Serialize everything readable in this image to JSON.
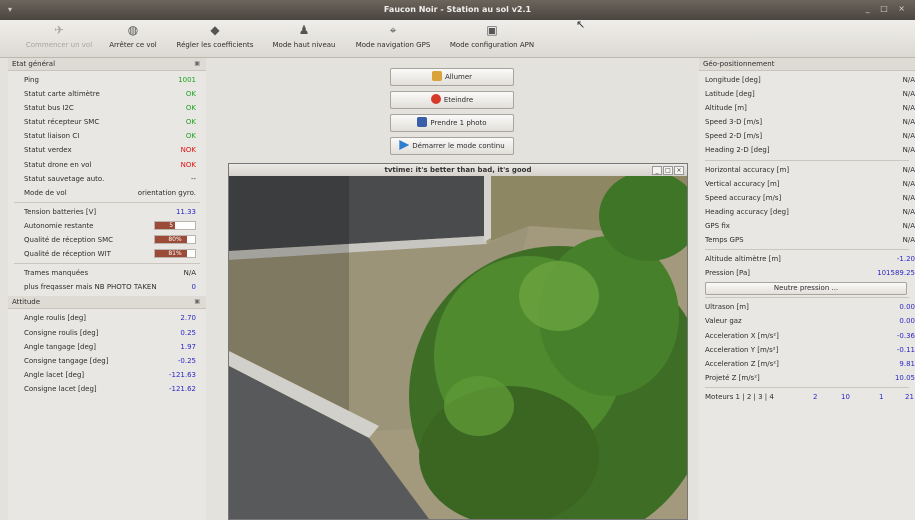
{
  "window": {
    "title": "Faucon Noir - Station au sol v2.1",
    "controls": [
      "_",
      "□",
      "×"
    ]
  },
  "toolbar": {
    "items": [
      {
        "label": "Commencer un vol",
        "icon": "plane-icon",
        "glyph": "✈",
        "enabled": false
      },
      {
        "label": "Arrêter ce vol",
        "icon": "globe-icon",
        "glyph": "◍",
        "enabled": true
      },
      {
        "label": "Régler les coefficients",
        "icon": "graduation-cap-icon",
        "glyph": "◆",
        "enabled": true
      },
      {
        "label": "Mode haut niveau",
        "icon": "joystick-icon",
        "glyph": "♟",
        "enabled": true
      },
      {
        "label": "Mode navigation GPS",
        "icon": "gps-icon",
        "glyph": "⌖",
        "enabled": true
      },
      {
        "label": "Mode configuration APN",
        "icon": "camera-config-icon",
        "glyph": "▣",
        "enabled": true
      }
    ]
  },
  "left": {
    "etat": {
      "title": "Etat général",
      "rows": [
        {
          "label": "Ping",
          "value": "1001",
          "status": "ok"
        },
        {
          "label": "Statut carte altimètre",
          "value": "OK",
          "status": "ok"
        },
        {
          "label": "Statut bus I2C",
          "value": "OK",
          "status": "ok"
        },
        {
          "label": "Statut récepteur SMC",
          "value": "OK",
          "status": "ok"
        },
        {
          "label": "Statut liaison CI",
          "value": "OK",
          "status": "ok"
        },
        {
          "label": "Statut verdex",
          "value": "NOK",
          "status": "nok"
        },
        {
          "label": "Statut drone en vol",
          "value": "NOK",
          "status": "nok"
        },
        {
          "label": "Statut sauvetage auto.",
          "value": "--",
          "status": "plain"
        },
        {
          "label": "Mode de vol",
          "value": "orientation gyro.",
          "status": "plain"
        }
      ],
      "battery": {
        "label": "Tension batteries [V]",
        "value": "11.33"
      },
      "bars": [
        {
          "label": "Autonomie restante",
          "value": "5 %",
          "fraction": 0.5
        },
        {
          "label": "Qualité de réception SMC",
          "value": "80%",
          "fraction": 0.8
        },
        {
          "label": "Qualité de réception WIT",
          "value": "81%",
          "fraction": 0.81
        }
      ],
      "extra": [
        {
          "label": "Trames manquées",
          "value": "N/A"
        },
        {
          "label": "plus freqasser mais NB PHOTO TAKEN",
          "value": "0"
        }
      ]
    },
    "attitude": {
      "title": "Attitude",
      "rows": [
        {
          "label": "Angle roulis [deg]",
          "value": "2.70"
        },
        {
          "label": "Consigne roulis [deg]",
          "value": "0.25"
        },
        {
          "label": "Angle tangage [deg]",
          "value": "1.97"
        },
        {
          "label": "Consigne tangage [deg]",
          "value": "-0.25"
        },
        {
          "label": "Angle lacet [deg]",
          "value": "-121.63"
        },
        {
          "label": "Consigne lacet [deg]",
          "value": "-121.62"
        }
      ]
    }
  },
  "center": {
    "buttons": [
      {
        "label": "Allumer",
        "icon": "key-icon",
        "color": "#d9a23a"
      },
      {
        "label": "Eteindre",
        "icon": "power-icon",
        "color": "#d83a2a"
      },
      {
        "label": "Prendre 1 photo",
        "icon": "photo-icon",
        "color": "#3a5fa8"
      },
      {
        "label": "Démarrer le mode continu",
        "icon": "play-icon",
        "color": "#2f7fd0"
      }
    ],
    "video": {
      "title": "tvtime: it's better than bad, it's good"
    }
  },
  "right": {
    "title": "Géo-positionnement",
    "group1": [
      {
        "label": "Longitude [deg]",
        "value": "N/A"
      },
      {
        "label": "Latitude [deg]",
        "value": "N/A"
      },
      {
        "label": "Altitude [m]",
        "value": "N/A"
      },
      {
        "label": "Speed 3-D [m/s]",
        "value": "N/A"
      },
      {
        "label": "Speed 2-D [m/s]",
        "value": "N/A"
      },
      {
        "label": "Heading 2-D [deg]",
        "value": "N/A"
      }
    ],
    "group2": [
      {
        "label": "Horizontal accuracy [m]",
        "value": "N/A"
      },
      {
        "label": "Vertical accuracy [m]",
        "value": "N/A"
      },
      {
        "label": "Speed accuracy [m/s]",
        "value": "N/A"
      },
      {
        "label": "Heading accuracy [deg]",
        "value": "N/A"
      },
      {
        "label": "GPS fix",
        "value": "N/A"
      },
      {
        "label": "Temps GPS",
        "value": "N/A"
      }
    ],
    "group3": [
      {
        "label": "Altitude altimètre [m]",
        "value": "-1.20"
      },
      {
        "label": "Pression [Pa]",
        "value": "101589.25"
      }
    ],
    "neutral_button": "Neutre pression ...",
    "group4": [
      {
        "label": "Ultrason [m]",
        "value": "0.00"
      },
      {
        "label": "Valeur gaz",
        "value": "0.00"
      },
      {
        "label": "Acceleration X [m/s²]",
        "value": "-0.36"
      },
      {
        "label": "Acceleration Y [m/s²]",
        "value": "-0.11"
      },
      {
        "label": "Acceleration Z [m/s²]",
        "value": "9.81"
      },
      {
        "label": "Projeté Z [m/s²]",
        "value": "10.05"
      }
    ],
    "motors": {
      "label": "Moteurs 1 | 2 | 3 | 4",
      "values": [
        "2",
        "10",
        "1",
        "21"
      ]
    }
  }
}
